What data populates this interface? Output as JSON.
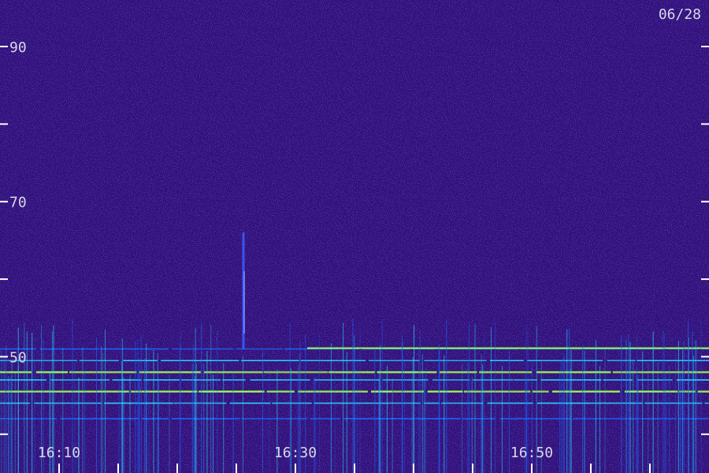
{
  "chart_data": {
    "type": "heatmap",
    "date_label": "06/28",
    "y_axis": {
      "tick_labels": [
        "90",
        "70",
        "50"
      ],
      "tick_values": [
        90,
        80,
        70,
        60,
        50,
        40
      ],
      "range": [
        35,
        96
      ]
    },
    "x_axis": {
      "tick_labels": [
        "16:10",
        "16:30",
        "16:50"
      ],
      "range": [
        "16:05",
        "17:05"
      ],
      "minor_tick_minutes": 5
    },
    "colors": {
      "background": "#30107a",
      "noise_bright": "#4a2ac8",
      "line_low": "#1a6bff",
      "line_mid": "#22e0ff",
      "line_high": "#9cff4a",
      "tick": "#ffffff",
      "label": "#d8d8e8"
    },
    "features": {
      "spike_time": "16:30",
      "emission_bands": [
        42,
        44,
        45.5,
        47,
        48,
        49.5,
        51
      ],
      "band_extends_after": "16:31"
    }
  }
}
